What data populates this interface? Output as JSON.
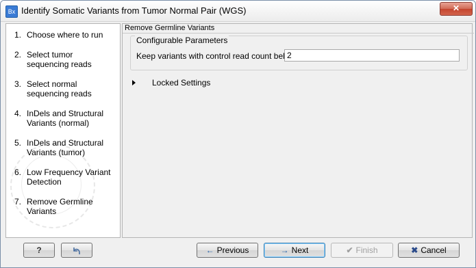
{
  "window": {
    "app_icon": "Bx",
    "title": "Identify Somatic Variants from Tumor Normal Pair (WGS)",
    "close_glyph": "✕"
  },
  "sidebar": {
    "steps": [
      {
        "num": "1.",
        "label": "Choose where to run"
      },
      {
        "num": "2.",
        "label": "Select tumor sequencing reads"
      },
      {
        "num": "3.",
        "label": "Select normal sequencing reads"
      },
      {
        "num": "4.",
        "label": "InDels and Structural Variants (normal)"
      },
      {
        "num": "5.",
        "label": "InDels and Structural Variants (tumor)"
      },
      {
        "num": "6.",
        "label": "Low Frequency Variant Detection"
      },
      {
        "num": "7.",
        "label": "Remove Germline Variants"
      }
    ]
  },
  "main": {
    "section_title": "Remove Germline Variants",
    "group_title": "Configurable Parameters",
    "param_label": "Keep variants with control read count below",
    "param_value": "2",
    "locked_label": "Locked Settings"
  },
  "buttons": {
    "help": "?",
    "reset_icon": "reset-icon",
    "previous": "Previous",
    "next": "Next",
    "finish": "Finish",
    "cancel": "Cancel"
  },
  "colors": {
    "close_red": "#c4452f",
    "arrow_blue": "#1f5ea8",
    "cancel_x": "#2a4a8a"
  }
}
